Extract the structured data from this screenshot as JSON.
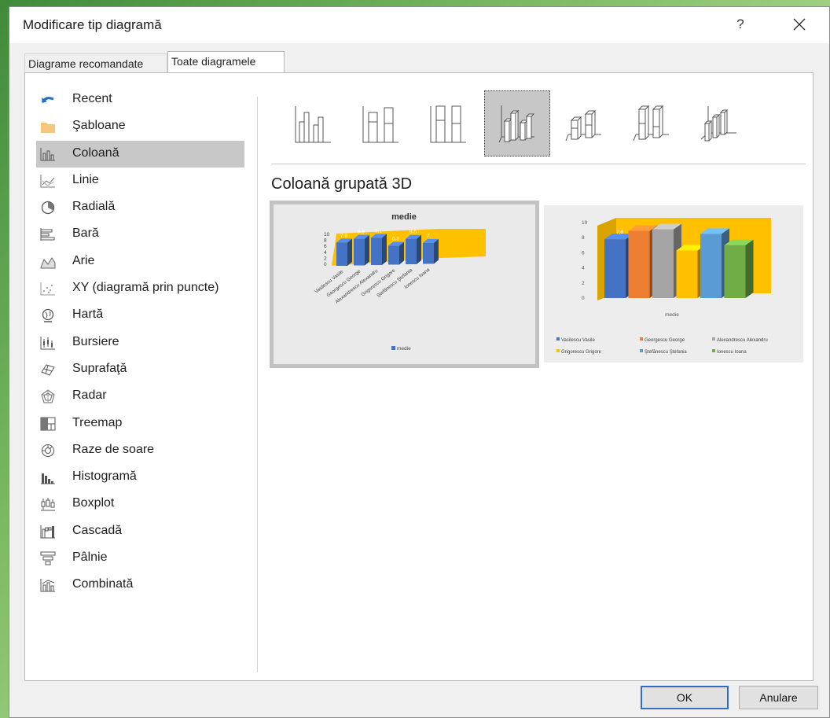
{
  "dialog": {
    "title": "Modificare tip diagramă",
    "help_label": "?"
  },
  "tabs": [
    {
      "label": "Diagrame recomandate"
    },
    {
      "label": "Toate diagramele"
    }
  ],
  "sidebar": {
    "items": [
      {
        "label": "Recent",
        "icon": "undo-icon"
      },
      {
        "label": "Şabloane",
        "icon": "folder-icon"
      },
      {
        "label": "Coloană",
        "icon": "column-chart-icon",
        "selected": true
      },
      {
        "label": "Linie",
        "icon": "line-chart-icon"
      },
      {
        "label": "Radială",
        "icon": "pie-chart-icon"
      },
      {
        "label": "Bară",
        "icon": "bar-chart-icon"
      },
      {
        "label": "Arie",
        "icon": "area-chart-icon"
      },
      {
        "label": "XY (diagramă prin puncte)",
        "icon": "scatter-chart-icon"
      },
      {
        "label": "Hartă",
        "icon": "map-globe-icon"
      },
      {
        "label": "Bursiere",
        "icon": "stock-chart-icon"
      },
      {
        "label": "Suprafaţă",
        "icon": "surface-chart-icon"
      },
      {
        "label": "Radar",
        "icon": "radar-chart-icon"
      },
      {
        "label": "Treemap",
        "icon": "treemap-icon"
      },
      {
        "label": "Raze de soare",
        "icon": "sunburst-icon"
      },
      {
        "label": "Histogramă",
        "icon": "histogram-icon"
      },
      {
        "label": "Boxplot",
        "icon": "boxplot-icon"
      },
      {
        "label": "Cascadă",
        "icon": "waterfall-icon"
      },
      {
        "label": "Pâlnie",
        "icon": "funnel-icon"
      },
      {
        "label": "Combinată",
        "icon": "combo-chart-icon"
      }
    ]
  },
  "subtypes": [
    {
      "icon": "clustered-column-icon"
    },
    {
      "icon": "stacked-column-icon"
    },
    {
      "icon": "100-stacked-column-icon"
    },
    {
      "icon": "3d-clustered-column-icon",
      "selected": true
    },
    {
      "icon": "3d-stacked-column-icon"
    },
    {
      "icon": "3d-100-stacked-column-icon"
    },
    {
      "icon": "3d-column-icon"
    }
  ],
  "selected_subtype_name": "Coloană grupată 3D",
  "colors": {
    "blue": "#4472c4",
    "orange": "#ed7d31",
    "gray": "#a5a5a5",
    "yellow": "#ffc000",
    "lightblue": "#5b9bd5",
    "green": "#70ad47",
    "wall": "#ffc000",
    "selection": "#c8c8c8",
    "accent": "#2b6fc7"
  },
  "chart_data": [
    {
      "type": "bar",
      "title": "medie",
      "categories": [
        "Vasilescu Vasile",
        "Georgescu George",
        "Alexandrescu Alexandru",
        "Grigorescu Grigore",
        "Ştefănescu Ştefania",
        "Ionescu Ioana"
      ],
      "series": [
        {
          "name": "medie",
          "values": [
            7.8,
            8.9,
            9.1,
            6.3,
            8.5,
            7
          ]
        }
      ],
      "data_labels": [
        "7,8",
        "8,9",
        "9,1",
        "6,3",
        "8,5",
        "7"
      ],
      "yticks": [
        "10",
        "8",
        "6",
        "4",
        "2",
        "0"
      ],
      "ylim": [
        0,
        10
      ],
      "legend": "bottom"
    },
    {
      "type": "bar",
      "xlabel": "medie",
      "categories": [
        "medie"
      ],
      "series": [
        {
          "name": "Vasilescu Vasile",
          "values": [
            7.8
          ]
        },
        {
          "name": "Georgescu George",
          "values": [
            8.9
          ]
        },
        {
          "name": "Alexandrescu Alexandru",
          "values": [
            9.1
          ]
        },
        {
          "name": "Grigorescu Grigore",
          "values": [
            6.3
          ]
        },
        {
          "name": "Ştefănescu Ştefania",
          "values": [
            8.5
          ]
        },
        {
          "name": "Ionescu Ioana",
          "values": [
            7
          ]
        }
      ],
      "data_labels": [
        "7,8"
      ],
      "yticks": [
        "10",
        "8",
        "6",
        "4",
        "2",
        "0"
      ],
      "ylim": [
        0,
        10
      ],
      "legend": "bottom"
    }
  ],
  "buttons": {
    "ok": "OK",
    "cancel": "Anulare"
  }
}
